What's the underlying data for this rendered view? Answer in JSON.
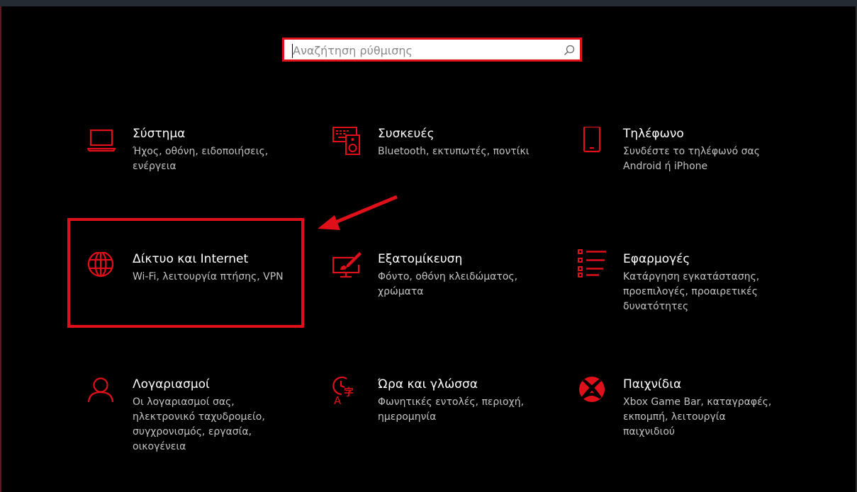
{
  "search": {
    "placeholder": "Αναζήτηση ρύθμισης",
    "value": ""
  },
  "accent_color": "#e0101a",
  "tiles": [
    {
      "id": "system",
      "icon": "laptop-icon",
      "title": "Σύστημα",
      "desc": "Ήχος, οθόνη, ειδοποιήσεις, ενέργεια"
    },
    {
      "id": "devices",
      "icon": "devices-icon",
      "title": "Συσκευές",
      "desc": "Bluetooth, εκτυπωτές, ποντίκι"
    },
    {
      "id": "phone",
      "icon": "phone-icon",
      "title": "Τηλέφωνο",
      "desc": "Συνδέστε το τηλέφωνό σας Android ή iPhone"
    },
    {
      "id": "network",
      "icon": "globe-icon",
      "title": "Δίκτυο και Internet",
      "desc": "Wi-Fi, λειτουργία πτήσης, VPN"
    },
    {
      "id": "personalization",
      "icon": "personalization-icon",
      "title": "Εξατομίκευση",
      "desc": "Φόντο, οθόνη κλειδώματος, χρώματα"
    },
    {
      "id": "apps",
      "icon": "apps-list-icon",
      "title": "Εφαρμογές",
      "desc": "Κατάργηση εγκατάστασης, προεπιλογές, προαιρετικές δυνατότητες"
    },
    {
      "id": "accounts",
      "icon": "person-icon",
      "title": "Λογαριασμοί",
      "desc": "Οι λογαριασμοί σας, ηλεκτρονικό ταχυδρομείο, συγχρονισμός, εργασία, οικογένεια"
    },
    {
      "id": "time-language",
      "icon": "time-language-icon",
      "title": "Ώρα και γλώσσα",
      "desc": "Φωνητικές εντολές, περιοχή, ημερομηνία"
    },
    {
      "id": "gaming",
      "icon": "xbox-icon",
      "title": "Παιχνίδια",
      "desc": "Xbox Game Bar, καταγραφές, εκπομπή, λειτουργία παιχνιδιού"
    }
  ]
}
